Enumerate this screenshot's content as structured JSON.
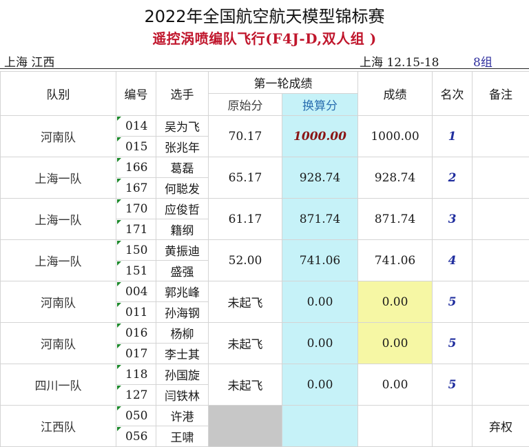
{
  "title": "2022年全国航空航天模型锦标赛",
  "subtitle": "遥控涡喷编队飞行(F4J-D,双人组 )",
  "info": {
    "left": "上海 江西",
    "location_date": "上海 12.15-18",
    "group": "8组"
  },
  "headers": {
    "team": "队别",
    "number": "编号",
    "player": "选手",
    "round1": "第一轮成绩",
    "raw": "原始分",
    "converted": "换算分",
    "score": "成绩",
    "rank": "名次",
    "remark": "备注"
  },
  "rows": [
    {
      "team": "河南队",
      "n1": "014",
      "p1": "吴为飞",
      "n2": "015",
      "p2": "张兆年",
      "raw": "70.17",
      "converted": "1000.00",
      "score": "1000.00",
      "rank": "1",
      "remark": ""
    },
    {
      "team": "上海一队",
      "n1": "166",
      "p1": "葛磊",
      "n2": "167",
      "p2": "何聪发",
      "raw": "65.17",
      "converted": "928.74",
      "score": "928.74",
      "rank": "2",
      "remark": ""
    },
    {
      "team": "上海一队",
      "n1": "170",
      "p1": "应俊哲",
      "n2": "171",
      "p2": "籍纲",
      "raw": "61.17",
      "converted": "871.74",
      "score": "871.74",
      "rank": "3",
      "remark": ""
    },
    {
      "team": "上海一队",
      "n1": "150",
      "p1": "黄振迪",
      "n2": "151",
      "p2": "盛强",
      "raw": "52.00",
      "converted": "741.06",
      "score": "741.06",
      "rank": "4",
      "remark": ""
    },
    {
      "team": "河南队",
      "n1": "004",
      "p1": "郭兆峰",
      "n2": "011",
      "p2": "孙海钢",
      "raw": "未起飞",
      "converted": "0.00",
      "score": "0.00",
      "rank": "5",
      "remark": ""
    },
    {
      "team": "河南队",
      "n1": "016",
      "p1": "杨柳",
      "n2": "017",
      "p2": "李士其",
      "raw": "未起飞",
      "converted": "0.00",
      "score": "0.00",
      "rank": "5",
      "remark": ""
    },
    {
      "team": "四川一队",
      "n1": "118",
      "p1": "孙国旋",
      "n2": "127",
      "p2": "闫铁林",
      "raw": "未起飞",
      "converted": "0.00",
      "score": "0.00",
      "rank": "5",
      "remark": ""
    },
    {
      "team": "江西队",
      "n1": "050",
      "p1": "许港",
      "n2": "056",
      "p2": "王啸",
      "raw": "",
      "converted": "",
      "score": "",
      "rank": "",
      "remark": "弃权"
    }
  ],
  "colors": {
    "title_red": "#c0162c",
    "rank_blue": "#1f2d9e",
    "converted_bg": "#c6f2f8",
    "yellow_bg": "#f6f7a4",
    "gray_bg": "#c7c7c7"
  }
}
